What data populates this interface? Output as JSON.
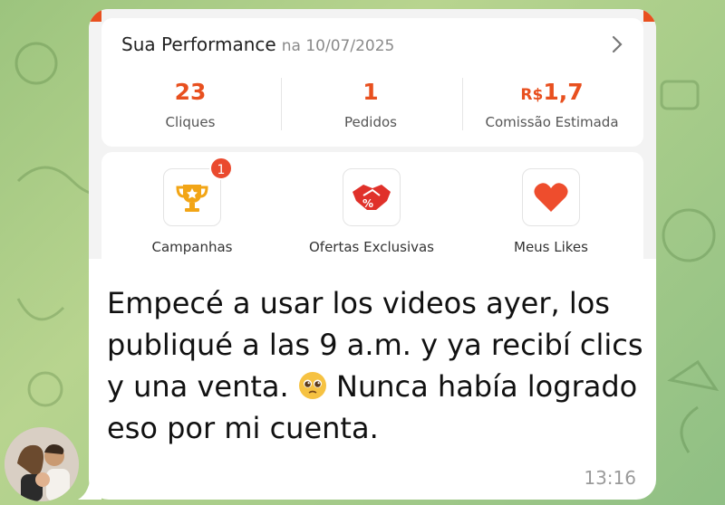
{
  "performance": {
    "title": "Sua Performance",
    "date_prefix": "na",
    "date": "10/07/2025",
    "stats": [
      {
        "value": "23",
        "label": "Cliques"
      },
      {
        "value": "1",
        "label": "Pedidos"
      },
      {
        "value_prefix": "R$",
        "value": "1,7",
        "label": "Comissão Estimada"
      }
    ]
  },
  "shortcuts": [
    {
      "label": "Campanhas",
      "icon": "trophy-icon",
      "badge": "1"
    },
    {
      "label": "Ofertas Exclusivas",
      "icon": "handshake-percent-icon"
    },
    {
      "label": "Meus Likes",
      "icon": "heart-icon"
    }
  ],
  "message": {
    "text_before_emoji": "Empecé a usar los videos ayer, los publiqué a las 9 a.m. y ya recibí clics y una venta.",
    "emoji": "pleading-face-emoji",
    "text_after_emoji": "Nunca había logrado eso por mi cuenta.",
    "time": "13:16"
  },
  "colors": {
    "accent": "#e8501f",
    "badge": "#ea4a2e",
    "heart": "#ee4d2d",
    "trophy": "#f2a516",
    "bubble": "#ffffff"
  }
}
